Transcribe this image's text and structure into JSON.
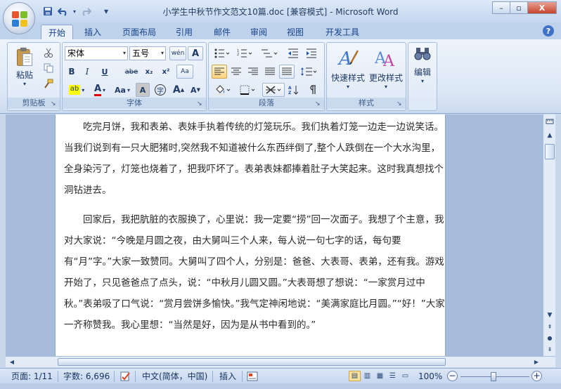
{
  "window": {
    "title": "小学生中秋节作文范文10篇.doc [兼容模式] - Microsoft Word",
    "minimize_glyph": "–",
    "maximize_glyph": "▫",
    "close_glyph": "X"
  },
  "quick_access": {
    "save_icon": "save-icon",
    "undo_icon": "undo-icon",
    "redo_icon": "redo-icon",
    "customize_glyph": "▾"
  },
  "tabs": [
    "开始",
    "插入",
    "页面布局",
    "引用",
    "邮件",
    "审阅",
    "视图",
    "开发工具"
  ],
  "help_glyph": "?",
  "ribbon": {
    "clipboard": {
      "label": "剪贴板",
      "paste_label": "粘贴"
    },
    "font": {
      "label": "字体",
      "font_name": "宋体",
      "font_size": "五号",
      "phonetic": "wén",
      "border_char": "A",
      "bold": "B",
      "italic": "I",
      "underline": "U",
      "strike": "abe",
      "subscript": "x₂",
      "superscript": "x²",
      "clear": "Aa",
      "highlight": "ab",
      "font_color": "A",
      "change_case": "Aa",
      "shading": "A",
      "enclose": "字",
      "grow": "A",
      "shrink": "A"
    },
    "paragraph": {
      "label": "段落"
    },
    "styles": {
      "label": "样式",
      "quick_styles_label": "快速样式",
      "change_styles_label": "更改样式"
    },
    "editing": {
      "label": "编辑"
    }
  },
  "document": {
    "paragraphs": [
      "吃完月饼，我和表弟、表妹手执着传统的灯笼玩乐。我们执着灯笼一边走一边说笑话。当我们说到有一只大肥猪时,突然我不知道被什么东西绊倒了,整个人跌倒在一个大水沟里，全身染污了，灯笼也烧着了，把我吓坏了。表弟表妹都捧着肚子大笑起来。这时我真想找个洞钻进去。",
      "回家后，我把肮脏的衣服换了，心里说：我一定要“捞”回一次面子。我想了个主意，我对大家说：“今晚是月圆之夜，由大舅叫三个人来，每人说一句七字的话，每句要有“月”字。”大家一致赞同。大舅叫了四个人，分别是：爸爸、大表哥、表弟，还有我。游戏开始了，只见爸爸点了点头，说：“中秋月儿圆又圆。”大表哥想了想说：“一家赏月过中秋。”表弟吸了口气说：“赏月尝饼多愉快。”我气定神闲地说：“美满家庭比月圆。”“好！”大家一齐称赞我。我心里想：“当然是好，因为是从书中看到的。”"
    ]
  },
  "status": {
    "page": "页面: 1/11",
    "words": "字数: 6,696",
    "language": "中文(简体，中国)",
    "insert_mode": "插入",
    "zoom": "100%"
  },
  "colors": {
    "ribbon_bg": "#dde8f6",
    "tab_text": "#15428b",
    "highlight": "#ffff00",
    "font_color": "#e00000",
    "selected_button": "#ffd37d"
  }
}
